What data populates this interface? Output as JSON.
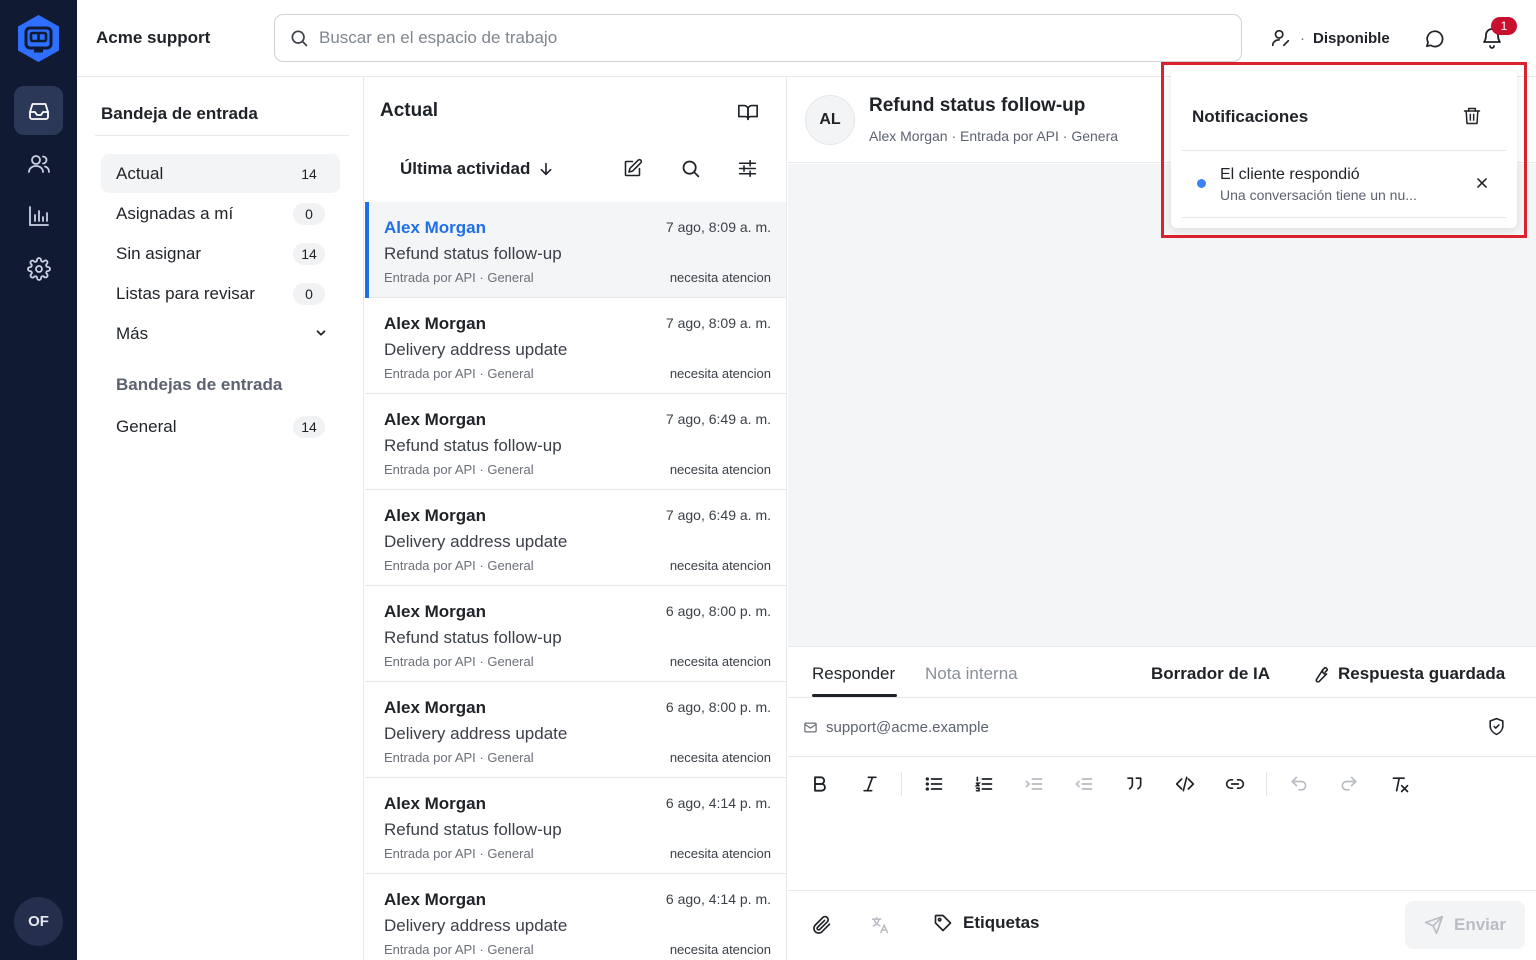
{
  "sidebar": {
    "nav": [
      "inbox-icon",
      "contacts-icon",
      "reports-icon",
      "settings-icon"
    ],
    "avatar_initials": "OF"
  },
  "topbar": {
    "brand": "Acme support",
    "search_placeholder": "Buscar en el espacio de trabajo",
    "status_label": "Disponible",
    "notification_count": "1"
  },
  "folders": {
    "title": "Bandeja de entrada",
    "items": [
      {
        "label": "Actual",
        "count": "14"
      },
      {
        "label": "Asignadas a mí",
        "count": "0"
      },
      {
        "label": "Sin asignar",
        "count": "14"
      },
      {
        "label": "Listas para revisar",
        "count": "0"
      },
      {
        "label": "Más"
      }
    ],
    "section_title": "Bandejas de entrada",
    "inboxes": [
      {
        "label": "General",
        "count": "14"
      }
    ]
  },
  "conversations": {
    "title": "Actual",
    "sort_label": "Última actividad",
    "rows": [
      {
        "name": "Alex Morgan",
        "time": "7 ago, 8:09 a. m.",
        "subject": "Refund status follow-up",
        "meta": "Entrada por API · General",
        "tag": "necesita atencion"
      },
      {
        "name": "Alex Morgan",
        "time": "7 ago, 8:09 a. m.",
        "subject": "Delivery address update",
        "meta": "Entrada por API · General",
        "tag": "necesita atencion"
      },
      {
        "name": "Alex Morgan",
        "time": "7 ago, 6:49 a. m.",
        "subject": "Refund status follow-up",
        "meta": "Entrada por API · General",
        "tag": "necesita atencion"
      },
      {
        "name": "Alex Morgan",
        "time": "7 ago, 6:49 a. m.",
        "subject": "Delivery address update",
        "meta": "Entrada por API · General",
        "tag": "necesita atencion"
      },
      {
        "name": "Alex Morgan",
        "time": "6 ago, 8:00 p. m.",
        "subject": "Refund status follow-up",
        "meta": "Entrada por API · General",
        "tag": "necesita atencion"
      },
      {
        "name": "Alex Morgan",
        "time": "6 ago, 8:00 p. m.",
        "subject": "Delivery address update",
        "meta": "Entrada por API · General",
        "tag": "necesita atencion"
      },
      {
        "name": "Alex Morgan",
        "time": "6 ago, 4:14 p. m.",
        "subject": "Refund status follow-up",
        "meta": "Entrada por API · General",
        "tag": "necesita atencion"
      },
      {
        "name": "Alex Morgan",
        "time": "6 ago, 4:14 p. m.",
        "subject": "Delivery address update",
        "meta": "Entrada por API · General",
        "tag": "necesita atencion"
      }
    ]
  },
  "detail": {
    "avatar_initials": "AL",
    "title": "Refund status follow-up",
    "contact": "Alex Morgan",
    "channel": "Entrada por API",
    "inbox": "Genera"
  },
  "composer": {
    "tab_reply": "Responder",
    "tab_note": "Nota interna",
    "ai_draft": "Borrador de IA",
    "saved_reply": "Respuesta guardada",
    "from_email": "support@acme.example",
    "tags_label": "Etiquetas",
    "send_label": "Enviar"
  },
  "notifications": {
    "title": "Notificaciones",
    "items": [
      {
        "title": "El cliente respondió",
        "description": "Una conversación tiene un nu..."
      }
    ]
  },
  "colors": {
    "rail": "#101a33",
    "accent": "#1f6feb",
    "badge": "#c8102e",
    "highlight": "#d9232e"
  }
}
